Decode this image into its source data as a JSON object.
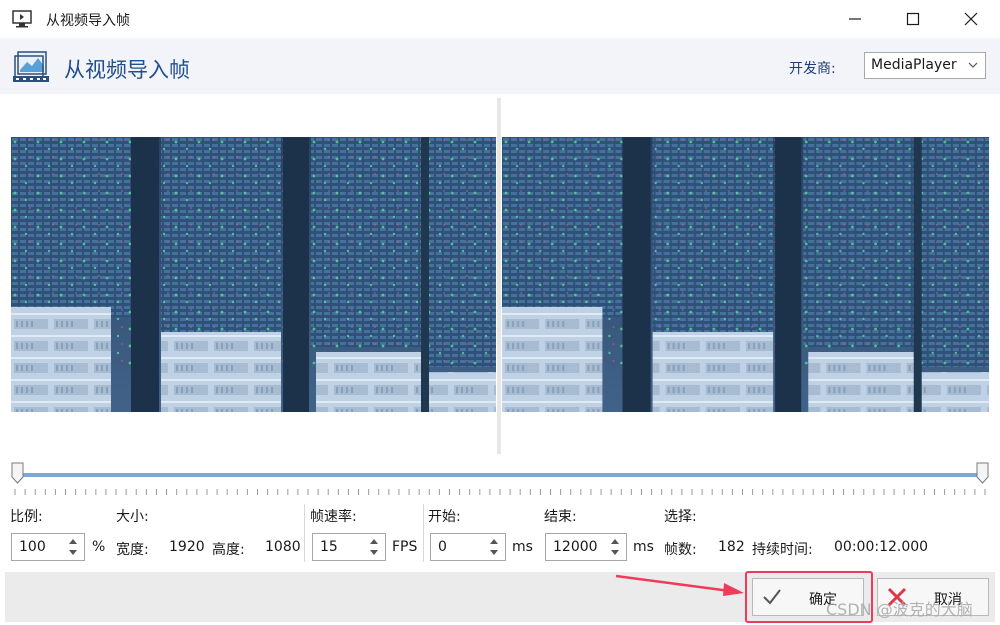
{
  "window": {
    "title": "从视频导入帧"
  },
  "header": {
    "title": "从视频导入帧",
    "developer_label": "开发商:",
    "developer_value": "MediaPlayer"
  },
  "controls": {
    "scale_label": "比例:",
    "scale_value": "100",
    "scale_unit": "%",
    "size_label": "大小:",
    "width_label": "宽度:",
    "width_value": "1920",
    "height_label": "高度:",
    "height_value": "1080",
    "fps_label": "帧速率:",
    "fps_value": "15",
    "fps_unit": "FPS",
    "start_label": "开始:",
    "start_value": "0",
    "start_unit": "ms",
    "end_label": "结束:",
    "end_value": "12000",
    "end_unit": "ms",
    "selection_label": "选择:",
    "frames_label": "帧数:",
    "frames_value": "182",
    "duration_label": "持续时间:",
    "duration_value": "00:00:12.000"
  },
  "slider": {
    "start_fraction": 0,
    "end_fraction": 1
  },
  "footer": {
    "ok_label": "确定",
    "cancel_label": "取消",
    "watermark": "CSDN @波克的大脑"
  },
  "colors": {
    "accent_blue": "#1f4f8c",
    "slider_blue": "#7aa8d8",
    "highlight_red": "#ef3b59",
    "cancel_red": "#e0364a"
  },
  "icons": [
    "monitor-icon",
    "minimize-icon",
    "maximize-icon",
    "close-icon",
    "video-frames-icon",
    "chevron-down-icon",
    "spin-arrows-icon",
    "checkmark-icon",
    "x-cancel-icon"
  ]
}
